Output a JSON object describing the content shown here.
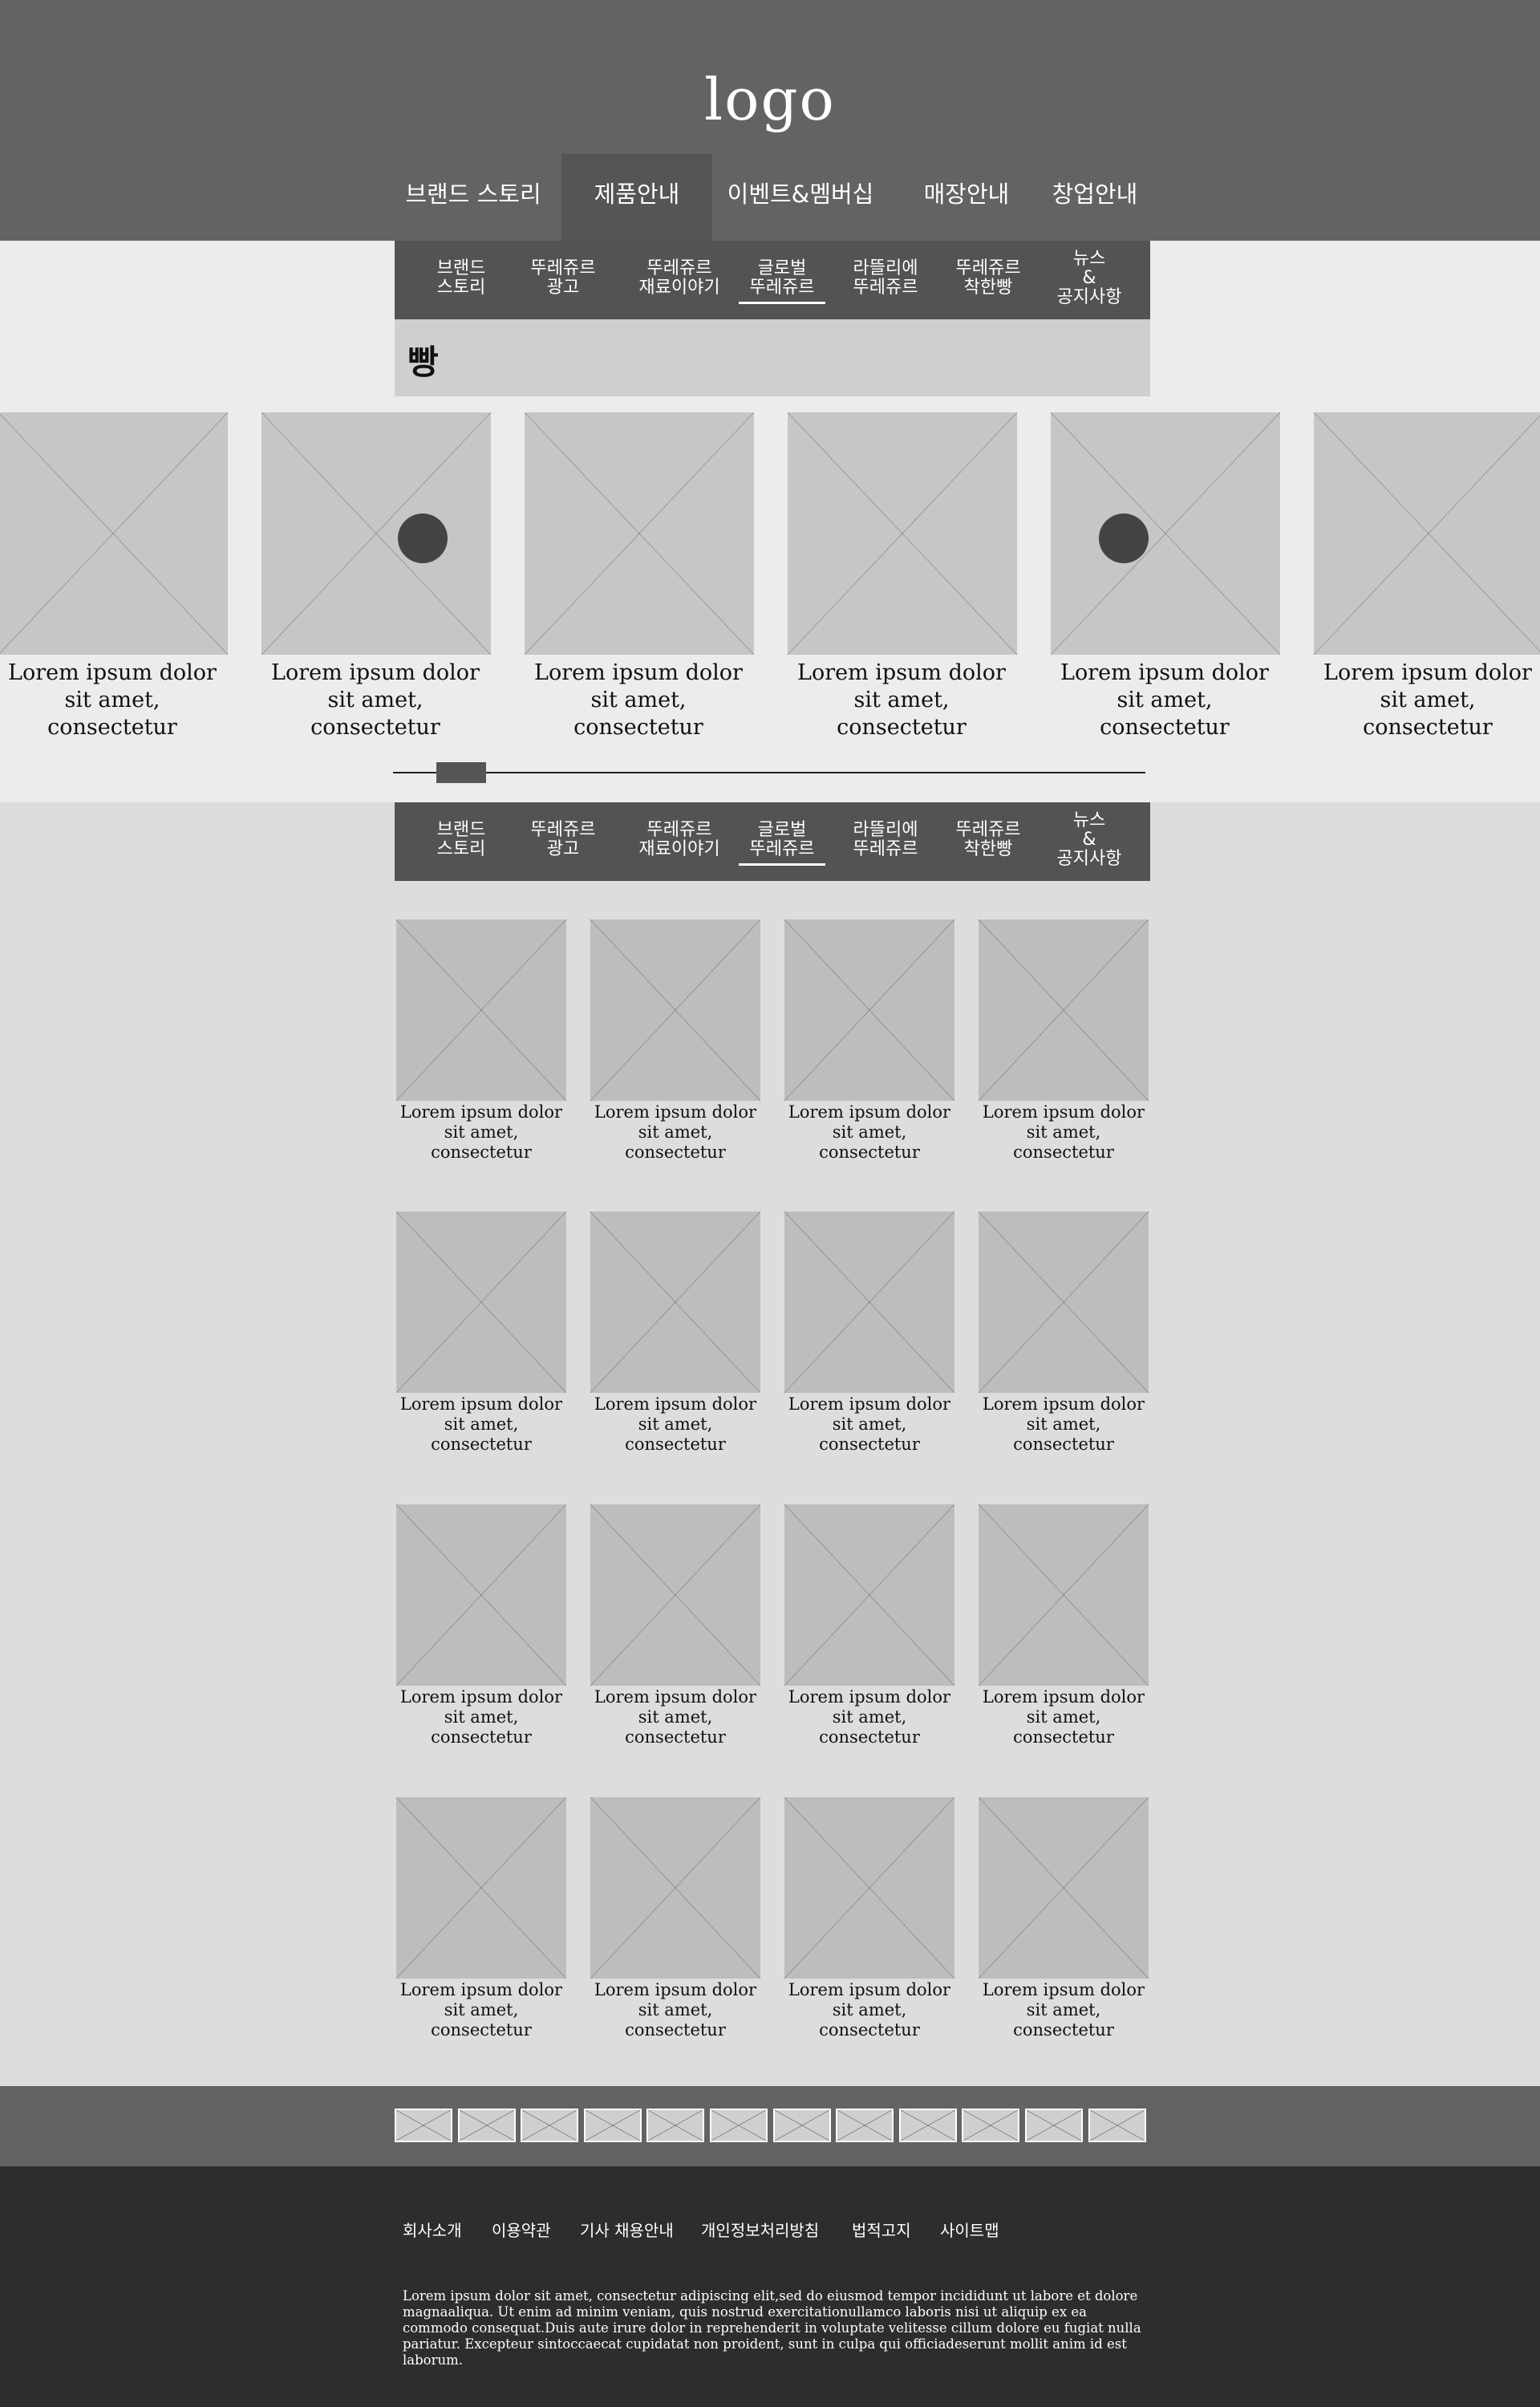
{
  "header": {
    "logo": "logo",
    "gnb": [
      {
        "label": "브랜드 스토리"
      },
      {
        "label": "제품안내"
      },
      {
        "label": "이벤트&멤버십"
      },
      {
        "label": "매장안내"
      },
      {
        "label": "창업안내"
      }
    ],
    "active_gnb": "제품안내"
  },
  "subnav": {
    "items": [
      {
        "label": "브랜드\n스토리"
      },
      {
        "label": "뚜레쥬르\n광고"
      },
      {
        "label": "뚜레쥬르\n재료이야기"
      },
      {
        "label": "글로벌\n뚜레쥬르"
      },
      {
        "label": "라뜰리에\n뚜레쥬르"
      },
      {
        "label": "뚜레쥬르\n착한빵"
      },
      {
        "label": "뉴스\n&\n공지사항"
      }
    ],
    "active": "글로벌 뚜레쥬르"
  },
  "category": {
    "title": "빵"
  },
  "slider": {
    "items": [
      {
        "caption": "Lorem ipsum dolor\nsit amet,\nconsectetur",
        "badge": false
      },
      {
        "caption": "Lorem ipsum dolor\nsit amet,\nconsectetur",
        "badge": true
      },
      {
        "caption": "Lorem ipsum dolor\nsit amet,\nconsectetur",
        "badge": false
      },
      {
        "caption": "Lorem ipsum dolor\nsit amet,\nconsectetur",
        "badge": false
      },
      {
        "caption": "Lorem ipsum dolor\nsit amet,\nconsectetur",
        "badge": true
      },
      {
        "caption": "Lorem ipsum dolor\nsit amet,\nconsectetur",
        "badge": false
      }
    ]
  },
  "grid": {
    "caption": "Lorem ipsum dolor\nsit amet,\nconsectetur",
    "rows": 4,
    "cols": 4
  },
  "banner": {
    "count": 12
  },
  "footer": {
    "links": [
      {
        "label": "회사소개"
      },
      {
        "label": "이용약관"
      },
      {
        "label": "기사 채용안내"
      },
      {
        "label": "개인정보처리방침"
      },
      {
        "label": "법적고지"
      },
      {
        "label": "사이트맵"
      }
    ],
    "text": "Lorem ipsum dolor sit amet, consectetur adipiscing elit,sed do eiusmod tempor incididunt ut labore et dolore magnaaliqua. Ut enim ad minim veniam, quis nostrud exercitationullamco laboris nisi ut aliquip ex ea commodo consequat.Duis aute irure dolor in reprehenderit in voluptate velitesse cillum dolore eu fugiat nulla pariatur. Excepteur sintoccaecat cupidatat non proident, sunt in culpa qui officiadeserunt mollit anim id est laborum."
  },
  "colors": {
    "header_bg": "#636363",
    "subnav_bg": "#535353",
    "footer_bg": "#2d2d2d",
    "placeholder": "#c6c6c6"
  }
}
